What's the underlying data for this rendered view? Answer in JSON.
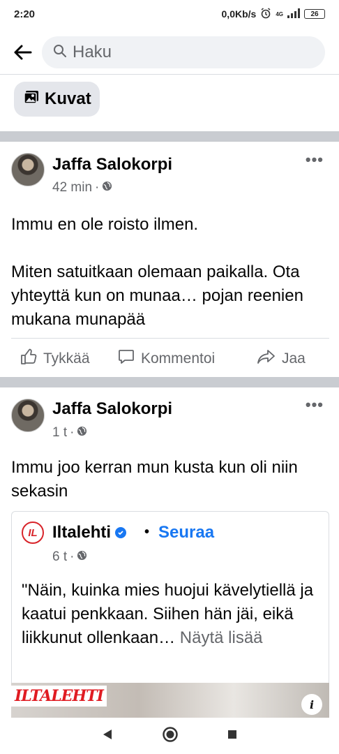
{
  "status_bar": {
    "time": "2:20",
    "net_speed": "0,0Kb/s",
    "alarm_icon": "alarm-icon",
    "network": "4G",
    "signal_icon": "signal-icon",
    "battery": "26"
  },
  "search": {
    "back_icon": "arrow-left-icon",
    "search_icon": "search-icon",
    "placeholder": "Haku"
  },
  "filter_chip": {
    "icon": "photos-icon",
    "label": "Kuvat"
  },
  "posts": [
    {
      "author": "Jaffa Salokorpi",
      "time": "42 min",
      "privacy_icon": "globe-icon",
      "text": "Immu en ole roisto ilmen.\n\nMiten satuitkaan olemaan paikalla. Ota yhteyttä kun on munaa… pojan reenien mukana munapää",
      "actions": {
        "like": "Tykkää",
        "comment": "Kommentoi",
        "share": "Jaa"
      }
    },
    {
      "author": "Jaffa Salokorpi",
      "time": "1 t",
      "privacy_icon": "globe-icon",
      "text": "Immu joo kerran mun kusta kun oli niin sekasin",
      "shared": {
        "logo_text": "IL",
        "page": "Iltalehti",
        "separator": "•",
        "follow": "Seuraa",
        "time": "6 t",
        "text": "\"Näin, kuinka mies huojui kävelytiellä ja kaatui penkkaan. Siihen hän jäi, eikä liikkunut ollenkaan…",
        "see_more": "Näytä lisää",
        "preview_logo": "ILTALEHTI",
        "info": "i"
      }
    }
  ],
  "nav": {
    "back": "triangle-back-icon",
    "home": "circle-home-icon",
    "recents": "square-recents-icon"
  },
  "colors": {
    "accent": "#1877f2",
    "muted": "#65676b",
    "separator": "#c9ccd1",
    "brand_red": "#e01b22"
  }
}
